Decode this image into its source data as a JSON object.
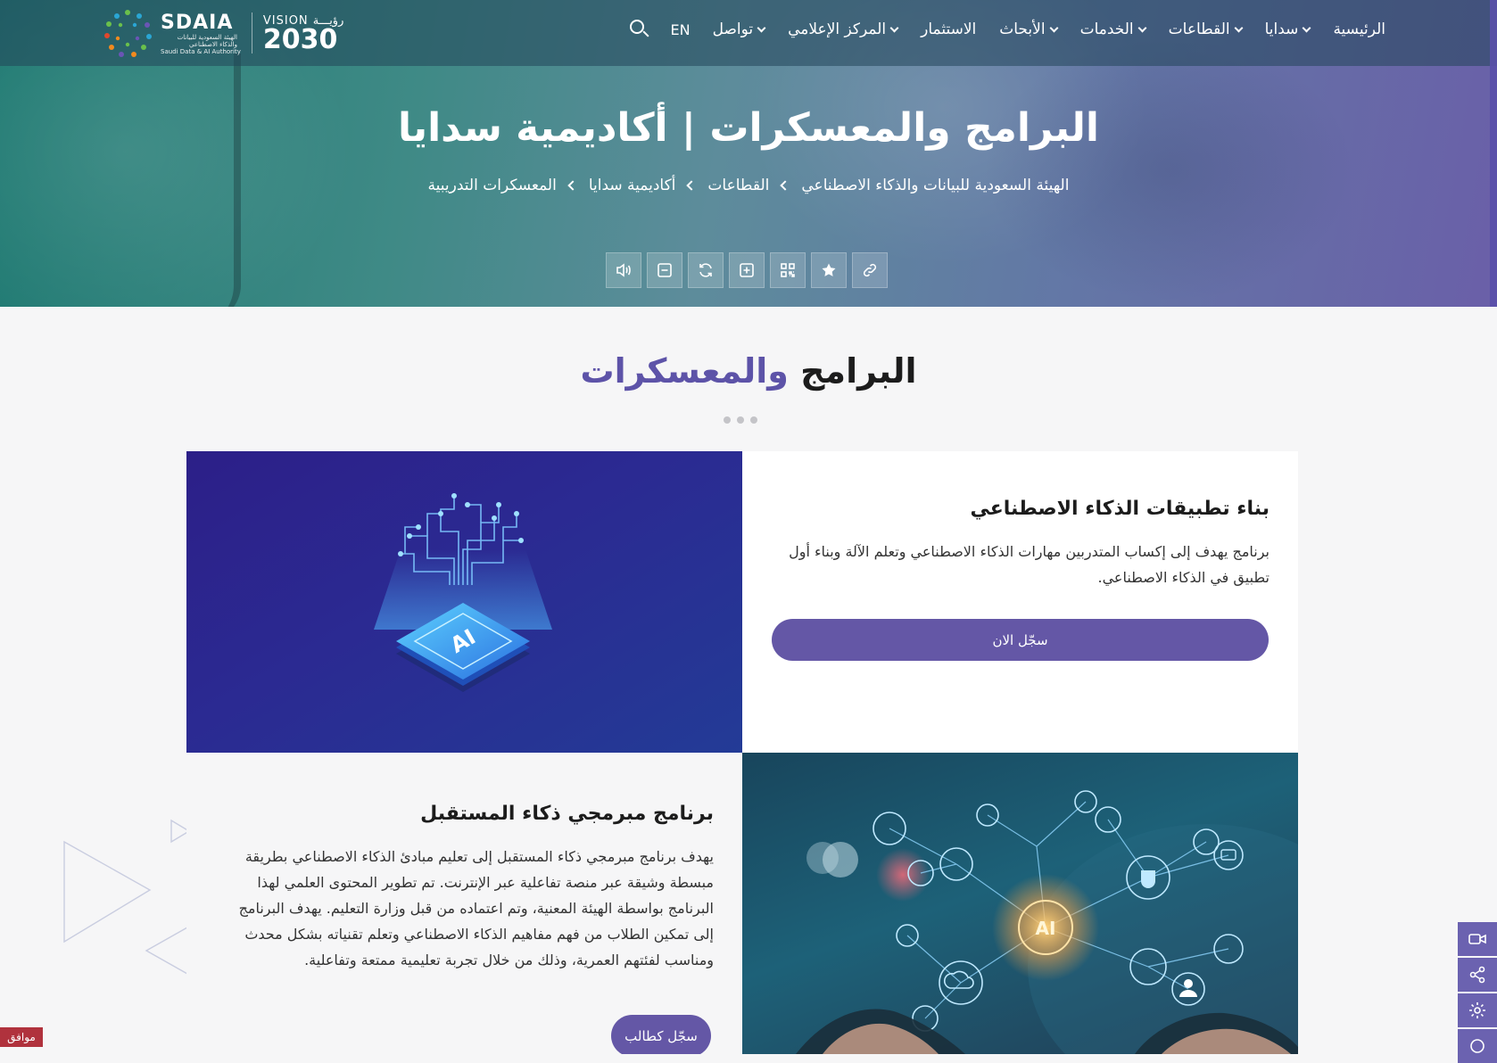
{
  "brand": {
    "sdaia_name": "SDAIA",
    "sdaia_sub_ar": "الهيئة السعودية للبيانات والذكاء الاصطناعي",
    "sdaia_sub_en": "Saudi Data & AI Authority",
    "vision_top": "VISION رؤيـــة",
    "vision_year": "2030"
  },
  "nav": {
    "items": [
      {
        "label": "الرئيسية",
        "has_menu": false
      },
      {
        "label": "سدايا",
        "has_menu": true
      },
      {
        "label": "القطاعات",
        "has_menu": true
      },
      {
        "label": "الخدمات",
        "has_menu": true
      },
      {
        "label": "الأبحاث",
        "has_menu": true
      },
      {
        "label": "الاستثمار",
        "has_menu": false
      },
      {
        "label": "المركز الإعلامي",
        "has_menu": true
      },
      {
        "label": "تواصل",
        "has_menu": true
      }
    ],
    "lang": "EN",
    "search_icon": "search-icon"
  },
  "hero": {
    "title": "البرامج والمعسكرات  |  أكاديمية سدايا",
    "breadcrumb": [
      "الهيئة السعودية للبيانات والذكاء الاصطناعي",
      "القطاعات",
      "أكاديمية سدايا",
      "المعسكرات التدريبية"
    ],
    "tools": [
      "speaker-icon",
      "zoom-out-icon",
      "reset-icon",
      "zoom-in-icon",
      "qr-code-icon",
      "star-icon",
      "link-icon"
    ]
  },
  "section": {
    "title_part1": "البرامج",
    "title_part2": "والمعسكرات"
  },
  "cards": [
    {
      "title": "بناء تطبيقات الذكاء الاصطناعي",
      "description": "برنامج يهدف إلى إكساب المتدربين مهارات الذكاء الاصطناعي وتعلم الآلة وبناء أول تطبيق في الذكاء الاصطناعي.",
      "button": "سجّل الان",
      "image": "ai-chip-illustration"
    },
    {
      "title": "برنامج مبرمجي ذكاء المستقبل",
      "description": "يهدف برنامج مبرمجي ذكاء المستقبل إلى تعليم مبادئ الذكاء الاصطناعي بطريقة مبسطة وشيقة عبر منصة تفاعلية عبر الإنترنت. تم تطوير المحتوى العلمي لهذا البرنامج بواسطة الهيئة المعنية، وتم اعتماده من قبل وزارة التعليم. يهدف البرنامج إلى تمكين الطلاب من فهم مفاهيم الذكاء الاصطناعي وتعلم تقنياته بشكل محدث ومناسب لفئتهم العمرية، وذلك من خلال تجربة تعليمية ممتعة وتفاعلية.",
      "button": "سجّل كطالب",
      "image": "ai-network-photo"
    }
  ],
  "node_labels": {
    "ai": "AI"
  },
  "side_rail": [
    "video-icon",
    "share-icon",
    "settings-icon",
    "circle-icon"
  ],
  "cookie": {
    "label": "موافق"
  },
  "colors": {
    "accent": "#6457a6",
    "title_accent": "#5d53a8",
    "cookie": "#b0323d"
  }
}
